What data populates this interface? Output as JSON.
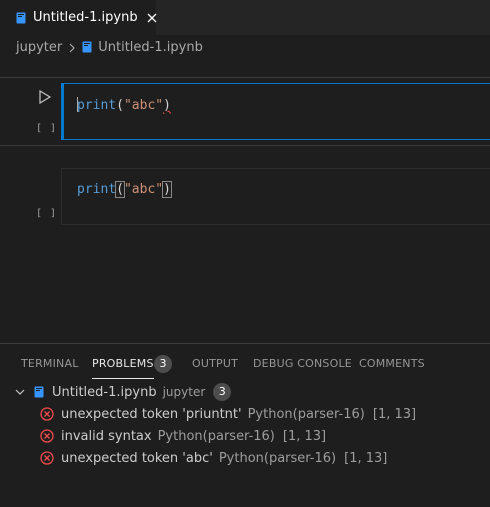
{
  "tab": {
    "title": "Untitled-1.ipynb"
  },
  "breadcrumb": {
    "folder": "jupyter",
    "file": "Untitled-1.ipynb"
  },
  "cells": [
    {
      "exec_label": "[ ]",
      "code": {
        "fn": "print",
        "open": "(",
        "str": "\"abc\"",
        "close": ")"
      }
    },
    {
      "exec_label": "[ ]",
      "code": {
        "fn": "print",
        "open": "(",
        "str": "\"abc\"",
        "close": ")"
      }
    }
  ],
  "panel": {
    "tabs": [
      {
        "label": "TERMINAL"
      },
      {
        "label": "PROBLEMS",
        "badge": "3"
      },
      {
        "label": "OUTPUT"
      },
      {
        "label": "DEBUG CONSOLE"
      },
      {
        "label": "COMMENTS"
      }
    ],
    "file_group": {
      "name": "Untitled-1.ipynb",
      "folder": "jupyter",
      "count": "3"
    },
    "problems": [
      {
        "message": "unexpected token 'priuntnt'",
        "source": "Python(parser-16)",
        "position": "[1, 13]"
      },
      {
        "message": "invalid syntax",
        "source": "Python(parser-16)",
        "position": "[1, 13]"
      },
      {
        "message": "unexpected token 'abc'",
        "source": "Python(parser-16)",
        "position": "[1, 13]"
      }
    ]
  },
  "colors": {
    "accent": "#007acc",
    "error": "#f14c4c",
    "keyword": "#569cd6",
    "string": "#ce9178"
  },
  "icons": [
    "notebook-file-icon",
    "close-icon",
    "chevron-right-icon",
    "run-cell-icon",
    "chevron-down-icon",
    "error-icon"
  ]
}
